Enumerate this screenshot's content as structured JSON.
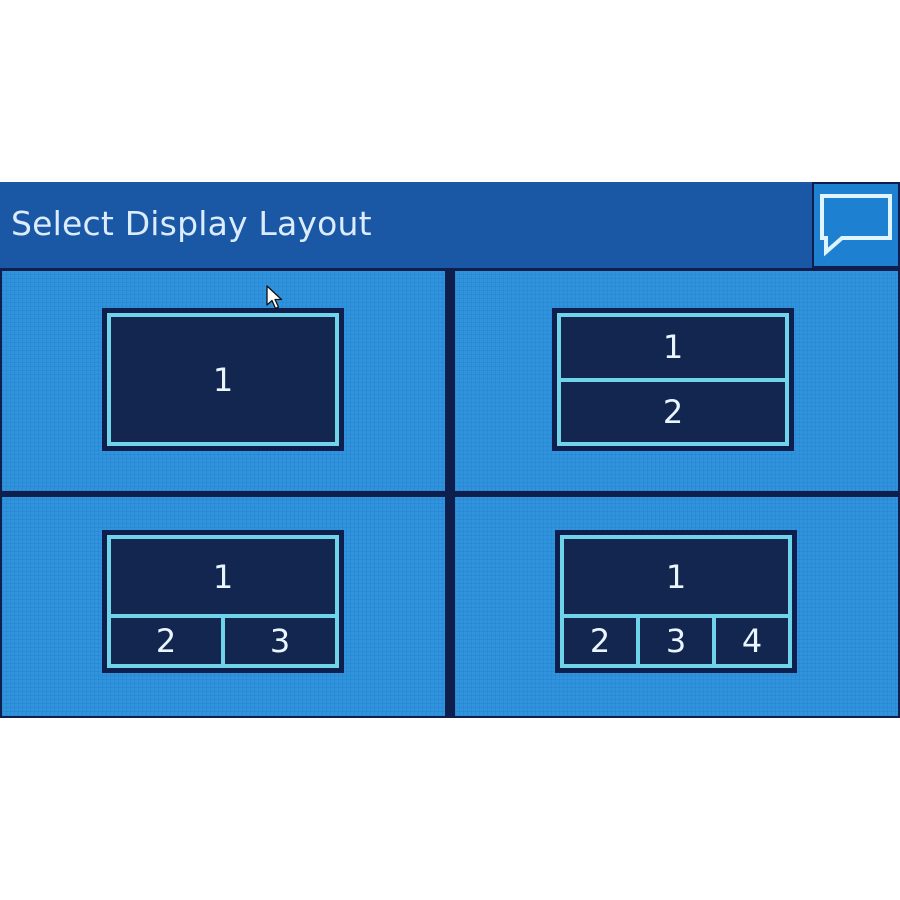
{
  "header": {
    "title": "Select Display Layout",
    "chat_icon": "speech-bubble-icon"
  },
  "layouts": [
    {
      "name": "single",
      "panes": [
        "1"
      ]
    },
    {
      "name": "split-two",
      "panes": [
        "1",
        "2"
      ]
    },
    {
      "name": "main-plus-two",
      "panes": [
        "1",
        "2",
        "3"
      ]
    },
    {
      "name": "main-plus-three",
      "panes": [
        "1",
        "2",
        "3",
        "4"
      ]
    }
  ],
  "colors": {
    "header_bg": "#1a58a6",
    "tile_bg": "#2f93de",
    "frame_border": "#6fd3ea",
    "pane_bg": "#122650",
    "divider": "#0f1f4d"
  }
}
